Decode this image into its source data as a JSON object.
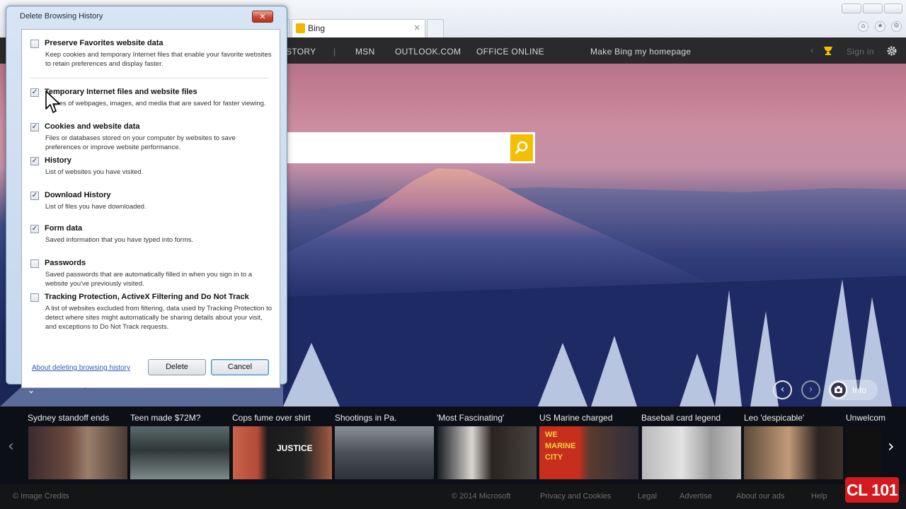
{
  "browser": {
    "tab_title": "Bing",
    "tab_close": "×"
  },
  "bing_nav": {
    "partial_history": "STORY",
    "separator": "|",
    "links": [
      "MSN",
      "OUTLOOK.COM",
      "OFFICE ONLINE"
    ],
    "homepage_link": "Make Bing my homepage",
    "sign_in": "Sign in"
  },
  "carousel": {
    "prev": "‹",
    "next": "›",
    "info_label": "Info"
  },
  "news": {
    "headlines": [
      "Sydney standoff ends",
      "Teen made $72M?",
      "Cops fume over shirt",
      "Shootings in Pa.",
      "'Most Fascinating'",
      "US Marine charged",
      "Baseball card legend",
      "Leo 'despicable'",
      "Unwelcom"
    ],
    "thumb_text_justice": "JUSTICE",
    "thumb_text_marine": [
      "WE",
      "MARINE",
      "CITY"
    ],
    "left_arrow": "‹",
    "right_arrow": "›"
  },
  "footer": {
    "image_credits": "© Image Credits",
    "copyright": "© 2014 Microsoft",
    "links": [
      "Privacy and Cookies",
      "Legal",
      "Advertise",
      "About our ads",
      "Help"
    ]
  },
  "badge": "CL 101",
  "dialog": {
    "title": "Delete Browsing History",
    "close_label": "✕",
    "options": [
      {
        "title": "Preserve Favorites website data",
        "desc": "Keep cookies and temporary Internet files that enable your favorite websites to retain preferences and display faster.",
        "checked": false
      },
      {
        "title": "Temporary Internet files and website files",
        "desc": "Copies of webpages, images, and media that are saved for faster viewing.",
        "checked": true
      },
      {
        "title": "Cookies and website data",
        "desc": "Files or databases stored on your computer by websites to save preferences or improve website performance.",
        "checked": true
      },
      {
        "title": "History",
        "desc": "List of websites you have visited.",
        "checked": true
      },
      {
        "title": "Download History",
        "desc": "List of files you have downloaded.",
        "checked": true
      },
      {
        "title": "Form data",
        "desc": "Saved information that you have typed into forms.",
        "checked": true
      },
      {
        "title": "Passwords",
        "desc": "Saved passwords that are automatically filled in when you sign in to a website you've previously visited.",
        "checked": false
      },
      {
        "title": "Tracking Protection, ActiveX Filtering and Do Not Track",
        "desc": "A list of websites excluded from filtering, data used by Tracking Protection to detect where sites might automatically be sharing details about your visit, and exceptions to Do Not Track requests.",
        "checked": false
      }
    ],
    "check_mark": "✓",
    "about_link": "About deleting browsing history",
    "delete_button": "Delete",
    "cancel_button": "Cancel"
  },
  "colors": {
    "bing_accent": "#f6be00",
    "nav_bg": "#2a2a2c",
    "badge_red": "#d4191f",
    "link_blue": "#2a5db8"
  },
  "icons": [
    "search-icon",
    "rewards-icon",
    "gear-icon",
    "camera-icon",
    "chevron-left-icon",
    "chevron-right-icon",
    "chevron-down-icon",
    "cursor-icon"
  ]
}
